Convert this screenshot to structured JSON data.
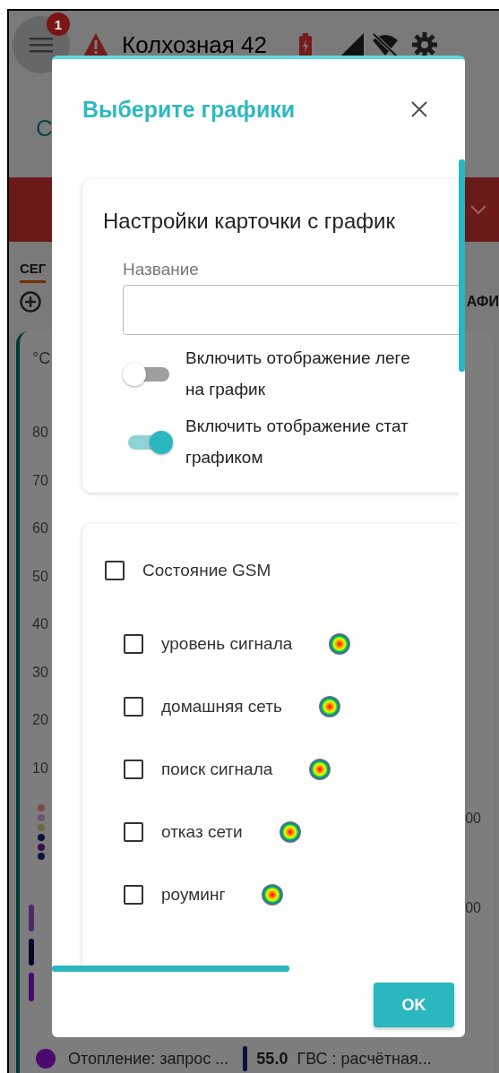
{
  "app": {
    "menu_badge": "1",
    "title": "Колхозная 42",
    "tab_fragment": "С",
    "section_fragment": "СЕГ",
    "toolbar_fragment": "АФИ",
    "chart": {
      "axis_unit": "°C",
      "y_labels": [
        "80",
        "70",
        "60",
        "50",
        "40",
        "30",
        "20",
        "10"
      ],
      "right_labels": [
        "00",
        "00"
      ]
    },
    "legend": [
      {
        "kind": "dot",
        "color": "#4a0a6e",
        "label": "Отопление: запрос ..."
      },
      {
        "kind": "bar",
        "color": "#0b1140",
        "reading": "55.0",
        "label": "ГВС : расчётная..."
      }
    ]
  },
  "dialog": {
    "title": "Выберите графики",
    "settings_card": {
      "title": "Настройки карточки с график",
      "name_label": "Название",
      "toggles": [
        {
          "lines": [
            "Включить отображение леге",
            "на график"
          ],
          "on": false
        },
        {
          "lines": [
            "Включить отображение стат",
            "графиком"
          ],
          "on": true
        }
      ]
    },
    "series": [
      {
        "label": "Состояние GSM",
        "checked": false,
        "children": [
          {
            "label": "уровень сигнала",
            "checked": false
          },
          {
            "label": "домашняя сеть",
            "checked": false
          },
          {
            "label": "поиск сигнала",
            "checked": false
          },
          {
            "label": "отказ сети",
            "checked": false
          },
          {
            "label": "роуминг",
            "checked": false
          }
        ]
      }
    ],
    "ok": "OK"
  }
}
